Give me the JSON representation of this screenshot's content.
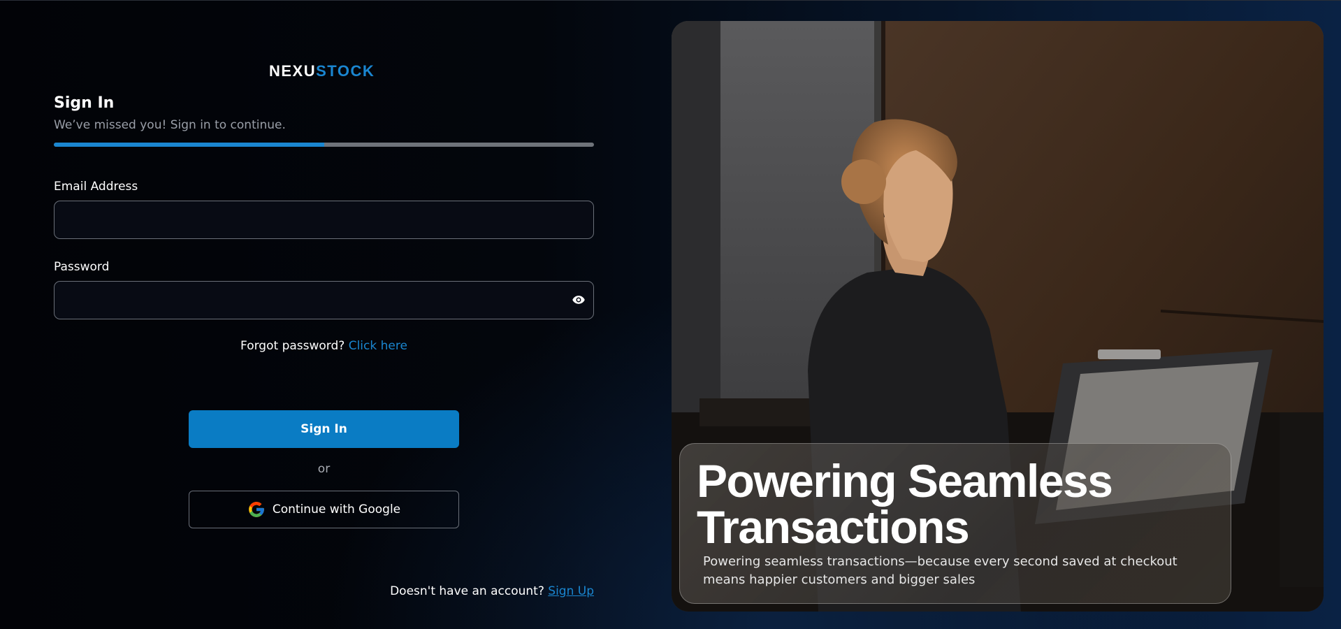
{
  "brand": {
    "logo_part1": "NEXU",
    "logo_part2": "STOCK"
  },
  "signin": {
    "title": "Sign In",
    "subtitle": "We’ve missed you! Sign in to continue.",
    "progress": 0.5
  },
  "form": {
    "email_label": "Email Address",
    "email_value": "",
    "password_label": "Password",
    "password_value": "",
    "forgot_text": "Forgot password?",
    "forgot_link": "Click here",
    "signin_button": "Sign In",
    "or_text": "or",
    "google_button": "Continue with Google",
    "signup_text": "Doesn't have an account?",
    "signup_link": "Sign Up"
  },
  "hero": {
    "title": "Powering Seamless Transactions",
    "text": "Powering seamless transactions—because every second saved at checkout means happier customers and bigger sales"
  },
  "icons": {
    "eye": "eye-icon",
    "google": "google-logo-icon"
  },
  "colors": {
    "accent": "#1a86d0",
    "button": "#0a7cc4",
    "background": "#03060c"
  }
}
